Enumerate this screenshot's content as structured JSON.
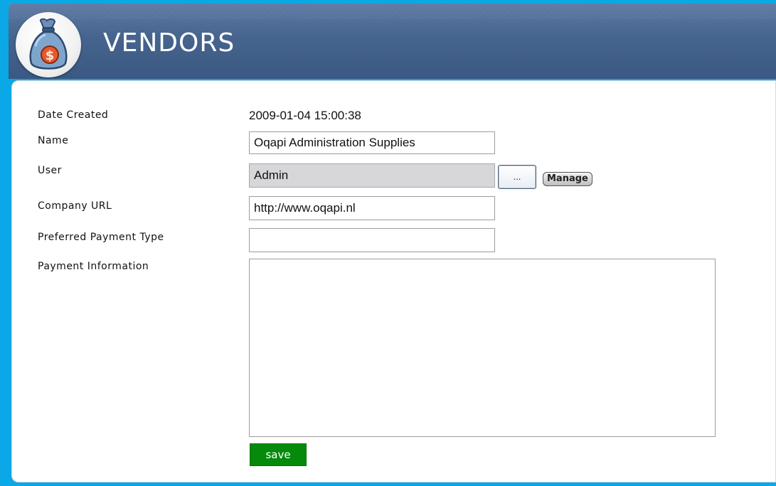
{
  "header": {
    "title": "VENDORS",
    "icon": "money-bag-icon"
  },
  "form": {
    "date_created": {
      "label": "Date Created",
      "value": "2009-01-04 15:00:38"
    },
    "name": {
      "label": "Name",
      "value": "Oqapi Administration Supplies"
    },
    "user": {
      "label": "User",
      "value": "Admin",
      "browse_label": "...",
      "manage_label": "Manage"
    },
    "company_url": {
      "label": "Company URL",
      "value": "http://www.oqapi.nl"
    },
    "preferred_payment_type": {
      "label": "Preferred Payment Type",
      "value": ""
    },
    "payment_information": {
      "label": "Payment Information",
      "value": ""
    },
    "save_label": "save"
  },
  "colors": {
    "background": "#0aa8e6",
    "header": "#45648e",
    "save_button": "#058a0c"
  }
}
